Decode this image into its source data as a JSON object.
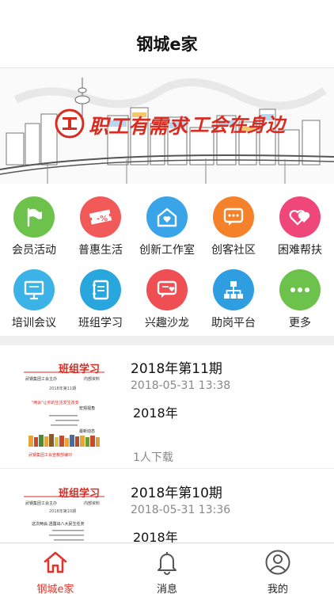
{
  "header": {
    "title": "钢城e家"
  },
  "banner": {
    "logo_text": "职工有需求",
    "slogan": "工会在身边"
  },
  "features": [
    {
      "label": "会员活动",
      "icon": "flag-icon",
      "color": "#6cc24a"
    },
    {
      "label": "普惠生活",
      "icon": "discount-ticket-icon",
      "color": "#f25a5a"
    },
    {
      "label": "创新工作室",
      "icon": "house-heart-icon",
      "color": "#3aa4e8"
    },
    {
      "label": "创客社区",
      "icon": "chat-bubble-icon",
      "color": "#f5812b"
    },
    {
      "label": "困难帮扶",
      "icon": "hearts-icon",
      "color": "#f0477a"
    },
    {
      "label": "培训会议",
      "icon": "presentation-board-icon",
      "color": "#3bb3e6"
    },
    {
      "label": "班组学习",
      "icon": "notebook-icon",
      "color": "#2aa6df"
    },
    {
      "label": "兴趣沙龙",
      "icon": "chat-heart-icon",
      "color": "#ef4e52"
    },
    {
      "label": "助岗平台",
      "icon": "org-chart-icon",
      "color": "#2e9ee0"
    },
    {
      "label": "更多",
      "icon": "more-dots-icon",
      "color": "#6cc24a"
    }
  ],
  "list": [
    {
      "title": "2018年第11期",
      "date": "2018-05-31 13:38",
      "desc": "2018年",
      "downloads": "1人下载",
      "cover": {
        "heading": "班组学习",
        "publisher": "武钢集团工会主办",
        "category": "内部资料",
        "issue": "2018年第11期",
        "lines": [
          "\"两会\"让你的生活发生改变",
          "宏观视角",
          "最新动态"
        ],
        "footer": "武钢集团工会宣教部编印"
      }
    },
    {
      "title": "2018年第10期",
      "date": "2018-05-31 13:36",
      "desc": "2018年",
      "downloads": "",
      "cover": {
        "heading": "班组学习",
        "publisher": "武钢集团工会主办",
        "category": "内部资料",
        "issue": "2018年第10期",
        "lines": [
          "这次两会,透露出八大民生任务"
        ],
        "footer": ""
      }
    }
  ],
  "tabbar": [
    {
      "label": "钢城e家",
      "icon": "home-icon",
      "active": true
    },
    {
      "label": "消息",
      "icon": "bell-icon",
      "active": false
    },
    {
      "label": "我的",
      "icon": "user-icon",
      "active": false
    }
  ],
  "colors": {
    "accent": "#e0352b",
    "banner_red": "#d92b20"
  }
}
